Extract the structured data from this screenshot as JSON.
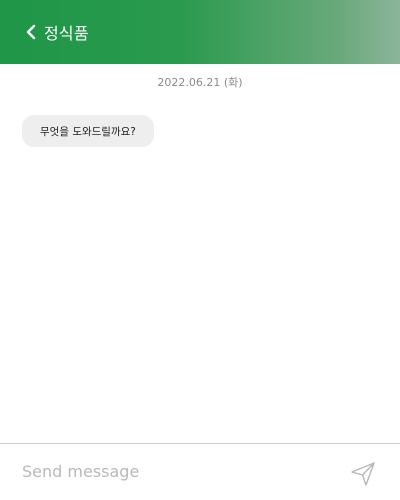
{
  "header": {
    "title": "정식품",
    "back_icon": "chevron-left-icon"
  },
  "chat": {
    "date": "2022.06.21 (화)",
    "messages": [
      {
        "text": "무엇을 도와드릴까요?"
      }
    ]
  },
  "composer": {
    "placeholder": "Send message",
    "value": "",
    "send_icon": "paper-plane-icon"
  },
  "colors": {
    "header_start": "#1f9648",
    "header_end": "#8bb59a",
    "bubble_bg": "#eeeeee"
  }
}
